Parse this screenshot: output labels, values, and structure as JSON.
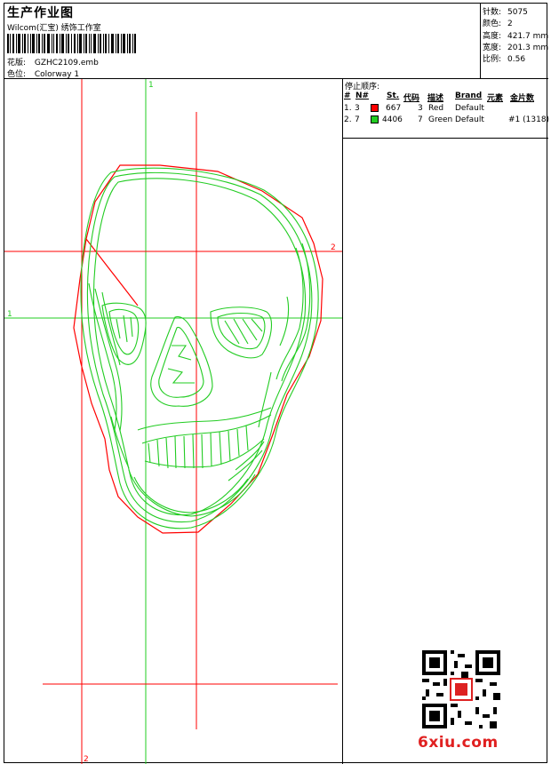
{
  "header": {
    "title": "生产作业图",
    "company": "Wilcom(汇宝) 绣饰工作室",
    "design_label": "花版:",
    "design_value": "GZHC2109.emb",
    "colorway_label": "色位:",
    "colorway_value": "Colorway 1"
  },
  "stats": [
    {
      "label": "针数:",
      "value": "5075"
    },
    {
      "label": "颜色:",
      "value": "2"
    },
    {
      "label": "高度:",
      "value": "421.7 mm"
    },
    {
      "label": "宽度:",
      "value": "201.3 mm"
    },
    {
      "label": "比例:",
      "value": "0.56"
    }
  ],
  "stop_sequence": {
    "title": "停止顺序:",
    "columns": [
      "#",
      "N#",
      "St.",
      "代码",
      "描述",
      "Brand",
      "元素",
      "金片数"
    ],
    "rows": [
      {
        "index": "1.",
        "needle": "3",
        "color": "#ff0000",
        "stitches": "667",
        "code": "3",
        "desc": "Red",
        "brand": "Default",
        "element": "",
        "sequins": ""
      },
      {
        "index": "2.",
        "needle": "7",
        "color": "#22cc22",
        "stitches": "4406",
        "code": "7",
        "desc": "Green",
        "brand": "Default",
        "element": "",
        "sequins": "#1 (1318)"
      }
    ]
  },
  "axis_markers": {
    "green_v": "1",
    "green_h": "1",
    "red_h": "2",
    "red_v": "2"
  },
  "colors": {
    "red": "#ff0000",
    "green": "#22cc22"
  },
  "watermark": "6xiu.com"
}
